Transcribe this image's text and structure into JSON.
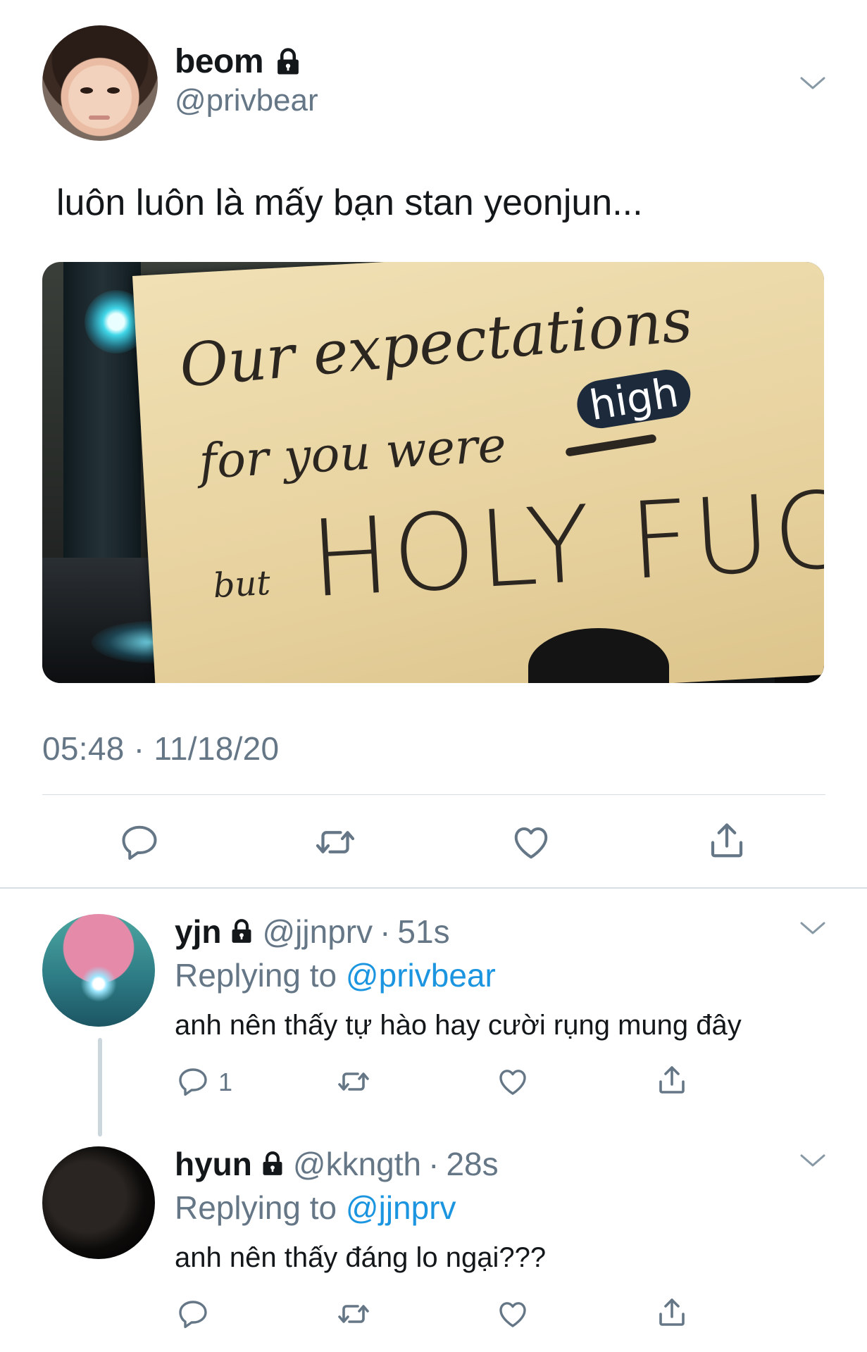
{
  "tweet": {
    "display_name": "beom",
    "handle": "@privbear",
    "text": "luôn luôn là mấy bạn stan yeonjun...",
    "timestamp": "05:48 · 11/18/20",
    "media": {
      "line1": "Our expectations",
      "line2": "for you were",
      "highlight": "high",
      "line3_small": "but",
      "line3": "HOLY FUCK"
    },
    "actions": [
      "reply-icon",
      "retweet-icon",
      "like-icon",
      "share-icon"
    ]
  },
  "replies": [
    {
      "display_name": "yjn",
      "handle": "@jjnprv",
      "dot": "·",
      "time": "51s",
      "replying_prefix": "Replying to",
      "replying_to": "@privbear",
      "text": "anh nên thấy tự hào hay cười rụng mung đây",
      "reply_count": "1"
    },
    {
      "display_name": "hyun",
      "handle": "@kkngth",
      "dot": "·",
      "time": "28s",
      "replying_prefix": "Replying to",
      "replying_to": "@jjnprv",
      "text": "anh nên thấy đáng lo ngại???",
      "reply_count": ""
    }
  ],
  "colors": {
    "text": "#14171a",
    "secondary": "#657786",
    "link": "#1b95e0",
    "divider": "#d8dde2",
    "icon": "#657786"
  }
}
